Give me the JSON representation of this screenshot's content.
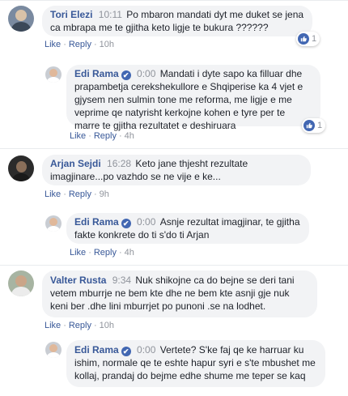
{
  "comments": [
    {
      "author": "Tori Elezi",
      "time": "10:11",
      "text": "Po mbaron mandati dyt me duket se jena ca mbrapa me te gjitha keto ligje te bukura ??????",
      "like_label": "Like",
      "reply_label": "Reply",
      "age": "10h",
      "reaction_count": "1",
      "avatar_icon": "person-avatar-icon"
    },
    {
      "author": "Edi Rama",
      "verified": "✔",
      "time": "0:00",
      "text": "Mandati i dyte sapo ka filluar dhe prapambetja cerekshekullore e Shqiperise ka 4 vjet e gjysem nen sulmin tone me reforma, me ligje e me veprime qe natyrisht kerkojne kohen e tyre per te marre te gjitha rezultatet e deshiruara",
      "like_label": "Like",
      "reply_label": "Reply",
      "age": "4h",
      "reaction_count": "1",
      "avatar_icon": "person-avatar-icon"
    },
    {
      "author": "Arjan Sejdi",
      "time": "16:28",
      "text": "Keto jane thjesht rezultate imagjinare...po vazhdo se ne vije e ke...",
      "like_label": "Like",
      "reply_label": "Reply",
      "age": "9h",
      "avatar_icon": "person-avatar-icon"
    },
    {
      "author": "Edi Rama",
      "verified": "✔",
      "time": "0:00",
      "text": "Asnje rezultat imagjinar, te gjitha fakte konkrete do ti s'do ti Arjan",
      "like_label": "Like",
      "reply_label": "Reply",
      "age": "4h",
      "avatar_icon": "person-avatar-icon"
    },
    {
      "author": "Valter Rusta",
      "time": "9:34",
      "text": "Nuk shikojne ca do bejne se deri tani vetem mburrje ne bem kte dhe ne bem kte asnji gje nuk keni ber .dhe lini mburrjet po punoni .se na lodhet.",
      "like_label": "Like",
      "reply_label": "Reply",
      "age": "10h",
      "avatar_icon": "person-avatar-icon"
    },
    {
      "author": "Edi Rama",
      "verified": "✔",
      "time": "0:00",
      "text": "Vertete? S'ke faj qe ke harruar ku ishim, normale qe te eshte hapur syri e s'te mbushet me kollaj, prandaj do bejme edhe shume me teper se kaq",
      "avatar_icon": "person-avatar-icon"
    }
  ],
  "colors": {
    "link": "#385898",
    "bubble": "#f2f3f5",
    "meta": "#90949c",
    "like": "#4267b2"
  }
}
